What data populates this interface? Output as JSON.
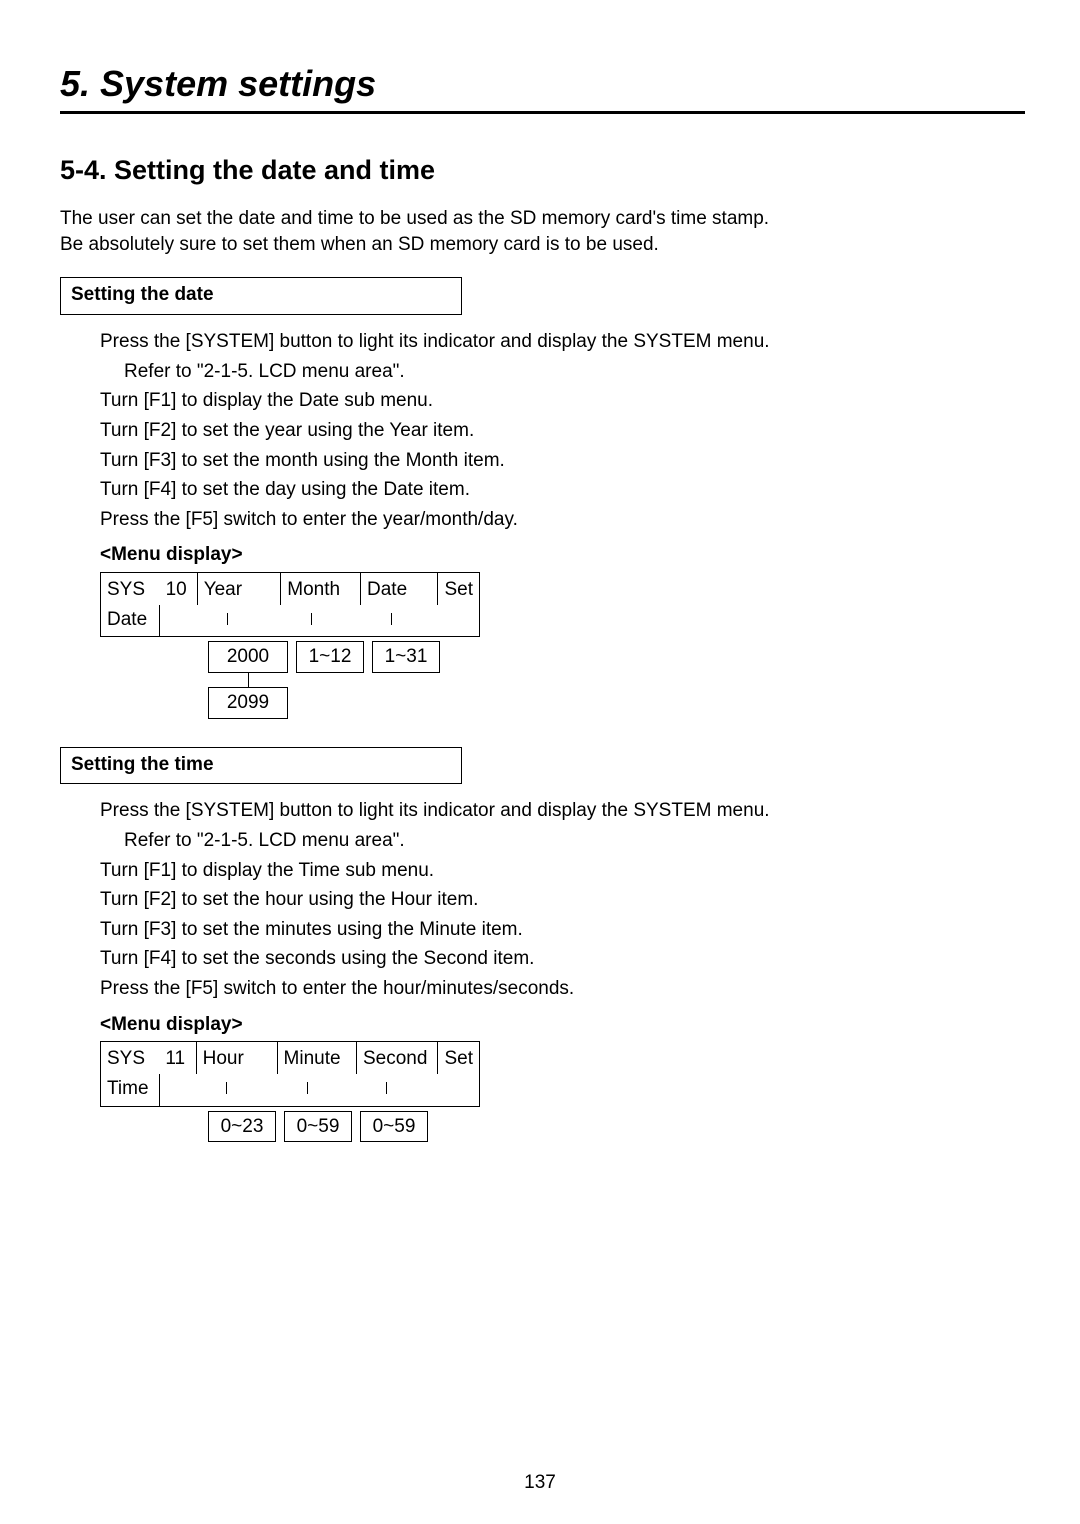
{
  "chapter_title": "5. System settings",
  "section_title": "5-4. Setting the date and time",
  "intro_lines": [
    "The user can set the date and time to be used as the SD memory card's time stamp.",
    "Be absolutely sure to set them when an SD memory card is to be used."
  ],
  "date_section": {
    "heading": "Setting the date",
    "steps": {
      "s1a": "Press the [SYSTEM] button to light its indicator and display the SYSTEM menu.",
      "s1b": "Refer to \"2-1-5. LCD menu area\".",
      "s2": "Turn [F1] to display the Date sub menu.",
      "s3": "Turn [F2] to set the year using the Year item.",
      "s4": "Turn [F3] to set the month using the Month item.",
      "s5": "Turn [F4] to set the day using the Date item.",
      "s6": "Press the [F5] switch to enter the year/month/day."
    },
    "menu_label": "<Menu display>",
    "menu": {
      "sys": "SYS",
      "num": "10",
      "name": "Date",
      "col1": "Year",
      "col2": "Month",
      "col3": "Date",
      "col4": "Set"
    },
    "ranges": {
      "year_a": "2000",
      "year_b": "2099",
      "month": "1~12",
      "date": "1~31"
    }
  },
  "time_section": {
    "heading": "Setting the time",
    "steps": {
      "s1a": "Press the [SYSTEM] button to light its indicator and display the SYSTEM menu.",
      "s1b": "Refer to \"2-1-5. LCD menu area\".",
      "s2": "Turn [F1] to display the Time sub menu.",
      "s3": "Turn [F2] to set the hour using the Hour item.",
      "s4": "Turn [F3] to set the minutes using the Minute item.",
      "s5": "Turn [F4] to set the seconds using the Second item.",
      "s6": "Press the [F5] switch to enter the hour/minutes/seconds."
    },
    "menu_label": "<Menu display>",
    "menu": {
      "sys": "SYS",
      "num": "11",
      "name": "Time",
      "col1": "Hour",
      "col2": "Minute",
      "col3": "Second",
      "col4": "Set"
    },
    "ranges": {
      "hour": "0~23",
      "minute": "0~59",
      "second": "0~59"
    }
  },
  "page_number": "137"
}
